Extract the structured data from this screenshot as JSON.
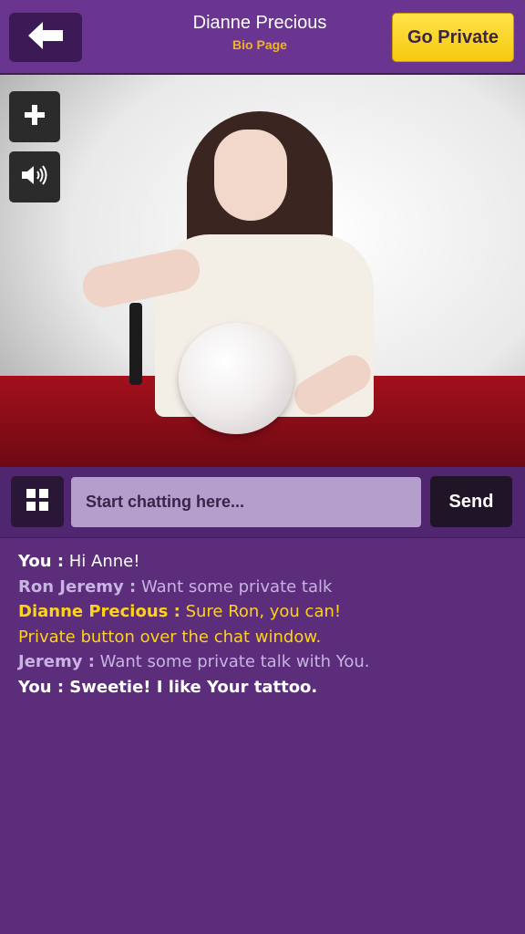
{
  "header": {
    "back_icon": "arrow-left-icon",
    "title": "Dianne Precious",
    "subtitle": "Bio Page",
    "go_private_label": "Go Private"
  },
  "video": {
    "zoom_icon": "plus-icon",
    "sound_icon": "speaker-icon"
  },
  "chat_input": {
    "menu_icon": "grid-icon",
    "placeholder": "Start chatting here...",
    "send_label": "Send"
  },
  "messages": [
    {
      "sender": "You :",
      "text": " Hi Anne!"
    },
    {
      "sender": "Ron Jeremy :",
      "text": " Want some private talk"
    },
    {
      "sender": "Dianne Precious :",
      "text": " Sure Ron, you can!"
    },
    {
      "sender": "",
      "text": "Private button over the chat window."
    },
    {
      "sender": "Jeremy :",
      "text": " Want some private talk with You."
    },
    {
      "sender": "You : ",
      "text": "Sweetie! I like Your tattoo."
    }
  ],
  "colors": {
    "background": "#5b2d7a",
    "header": "#6a3590",
    "accent_yellow": "#ffd21a",
    "go_private": "#f6c90e"
  }
}
